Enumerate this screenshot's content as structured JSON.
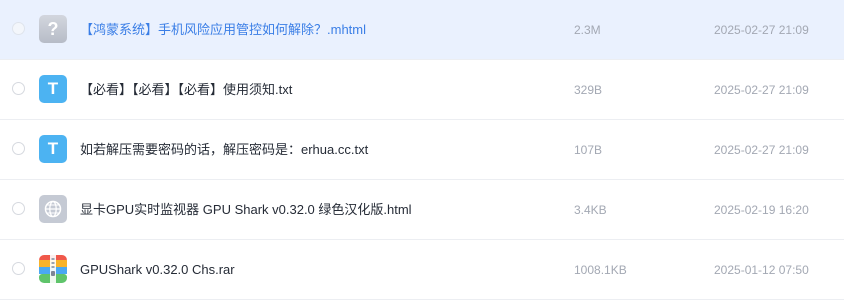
{
  "colors": {
    "selected_row_bg": "#eaf1fe",
    "selected_name": "#3a7ee6",
    "txt_icon": "#4cb3f2",
    "meta_text": "#a3a8b3"
  },
  "files": [
    {
      "name": "【鸿蒙系统】手机风险应用管控如何解除？.mhtml",
      "size": "2.3M",
      "date": "2025-02-27 21:09",
      "icon": "unknown-file-icon",
      "icon_glyph": "?",
      "selected": true
    },
    {
      "name": "【必看】【必看】【必看】使用须知.txt",
      "size": "329B",
      "date": "2025-02-27 21:09",
      "icon": "text-file-icon",
      "icon_glyph": "T",
      "selected": false
    },
    {
      "name": "如若解压需要密码的话，解压密码是：erhua.cc.txt",
      "size": "107B",
      "date": "2025-02-27 21:09",
      "icon": "text-file-icon",
      "icon_glyph": "T",
      "selected": false
    },
    {
      "name": "显卡GPU实时监视器 GPU Shark v0.32.0 绿色汉化版.html",
      "size": "3.4KB",
      "date": "2025-02-19 16:20",
      "icon": "globe-icon",
      "selected": false
    },
    {
      "name": "GPUShark v0.32.0 Chs.rar",
      "size": "1008.1KB",
      "date": "2025-01-12 07:50",
      "icon": "archive-icon",
      "selected": false
    }
  ]
}
